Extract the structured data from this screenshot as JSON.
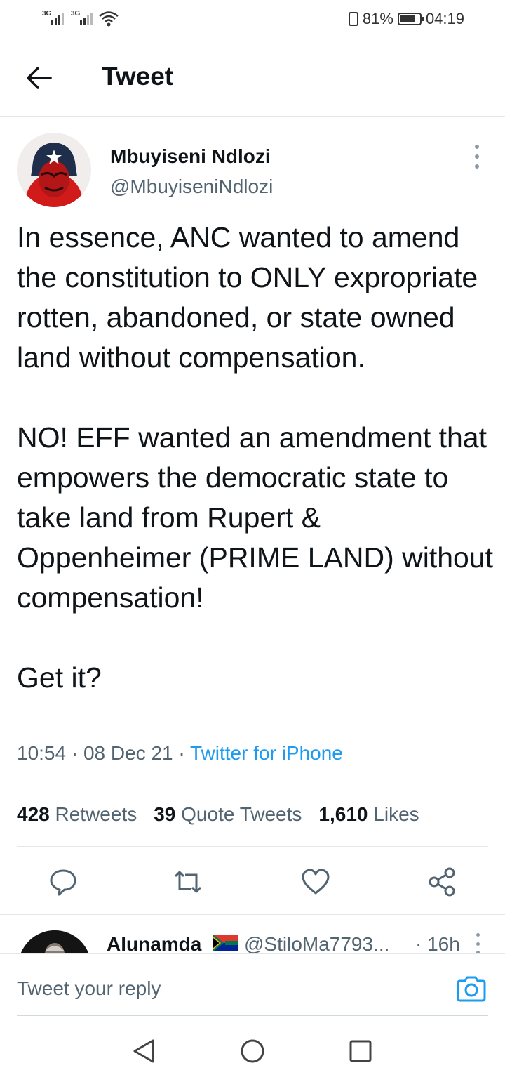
{
  "status_bar": {
    "sim1": "3G",
    "sim2": "3G",
    "battery_text": "81%",
    "battery_level": 0.81,
    "time": "04:19"
  },
  "header": {
    "title": "Tweet",
    "back_icon": "arrow-left-icon"
  },
  "tweet": {
    "author_name": "Mbuyiseni Ndlozi",
    "author_handle": "@MbuyiseniNdlozi",
    "text": "In essence, ANC wanted to amend the constitution to ONLY expropriate rotten, abandoned, or state owned land without compensation.\n\nNO! EFF wanted an amendment that empowers the democratic state to take land from Rupert & Oppenheimer (PRIME LAND) without compensation!\n\nGet it?",
    "time": "10:54",
    "date": "08 Dec 21",
    "separator": " · ",
    "source": "Twitter for iPhone",
    "stats": [
      {
        "count": "428",
        "label": "Retweets"
      },
      {
        "count": "39",
        "label": "Quote Tweets"
      },
      {
        "count": "1,610",
        "label": "Likes"
      }
    ],
    "actions": [
      "reply-icon",
      "retweet-icon",
      "like-icon",
      "share-icon"
    ]
  },
  "reply": {
    "name": "Alunamda",
    "handle": "@StiloMa7793...",
    "time": "· 16h"
  },
  "compose": {
    "placeholder": "Tweet your reply"
  },
  "nav": [
    "back-triangle-icon",
    "home-circle-icon",
    "recents-square-icon"
  ],
  "colors": {
    "accent": "#1d9bf0",
    "secondary_text": "#536471",
    "primary_text": "#0f1419"
  }
}
